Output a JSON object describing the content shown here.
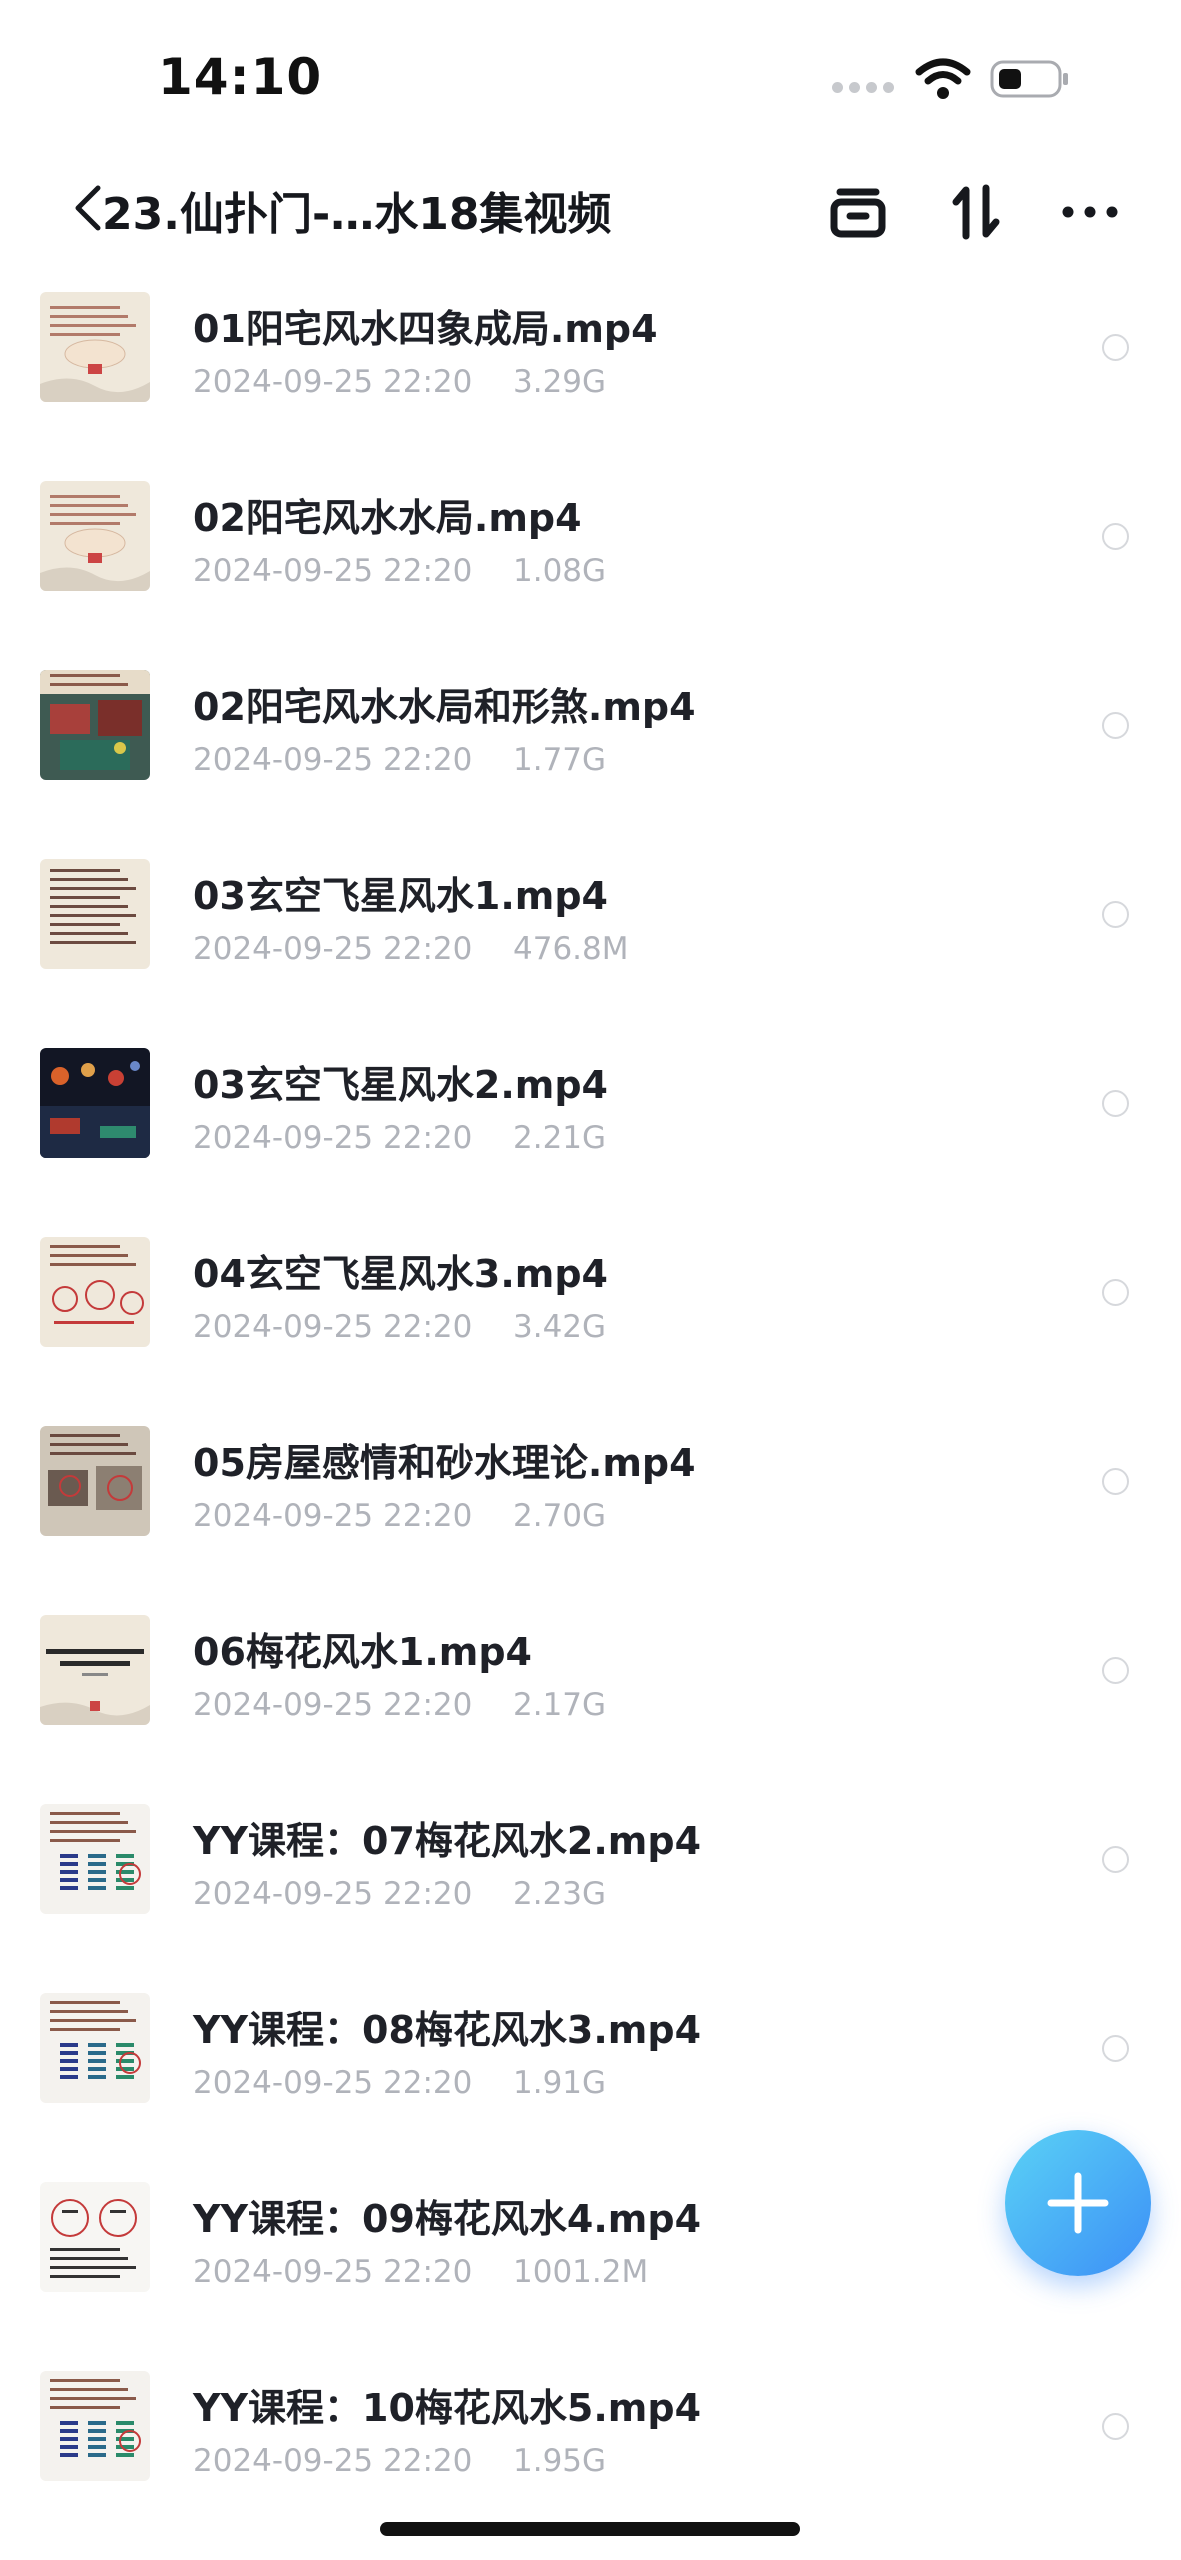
{
  "status_bar": {
    "time": "14:10"
  },
  "nav": {
    "title": "23.仙扑门-…水18集视频",
    "icons": [
      "back-chevron-icon",
      "archive-box-icon",
      "sort-icon",
      "more-icon"
    ]
  },
  "colors": {
    "accent_start": "#5ad2f5",
    "accent_end": "#3c8ff7",
    "meta_text": "#b0b3ba",
    "title_text": "#1f2128"
  },
  "files": [
    {
      "name": "01阳宅风水四象成局.mp4",
      "date": "2024-09-25 22:20",
      "size": "3.29G",
      "thumb": "scroll-light"
    },
    {
      "name": "02阳宅风水水局.mp4",
      "date": "2024-09-25 22:20",
      "size": "1.08G",
      "thumb": "scroll-light"
    },
    {
      "name": "02阳宅风水水局和形煞.mp4",
      "date": "2024-09-25 22:20",
      "size": "1.77G",
      "thumb": "scene-colorful"
    },
    {
      "name": "03玄空飞星风水1.mp4",
      "date": "2024-09-25 22:20",
      "size": "476.8M",
      "thumb": "text-light"
    },
    {
      "name": "03玄空飞星风水2.mp4",
      "date": "2024-09-25 22:20",
      "size": "2.21G",
      "thumb": "scene-dark"
    },
    {
      "name": "04玄空飞星风水3.mp4",
      "date": "2024-09-25 22:20",
      "size": "3.42G",
      "thumb": "diagram-red"
    },
    {
      "name": "05房屋感情和砂水理论.mp4",
      "date": "2024-09-25 22:20",
      "size": "2.70G",
      "thumb": "scene-room"
    },
    {
      "name": "06梅花风水1.mp4",
      "date": "2024-09-25 22:20",
      "size": "2.17G",
      "thumb": "scroll-title"
    },
    {
      "name": "YY课程：07梅花风水2.mp4",
      "date": "2024-09-25 22:20",
      "size": "2.23G",
      "thumb": "hexagram"
    },
    {
      "name": "YY课程：08梅花风水3.mp4",
      "date": "2024-09-25 22:20",
      "size": "1.91G",
      "thumb": "hexagram"
    },
    {
      "name": "YY课程：09梅花风水4.mp4",
      "date": "2024-09-25 22:20",
      "size": "1001.2M",
      "thumb": "sketch"
    },
    {
      "name": "YY课程：10梅花风水5.mp4",
      "date": "2024-09-25 22:20",
      "size": "1.95G",
      "thumb": "hexagram"
    }
  ]
}
